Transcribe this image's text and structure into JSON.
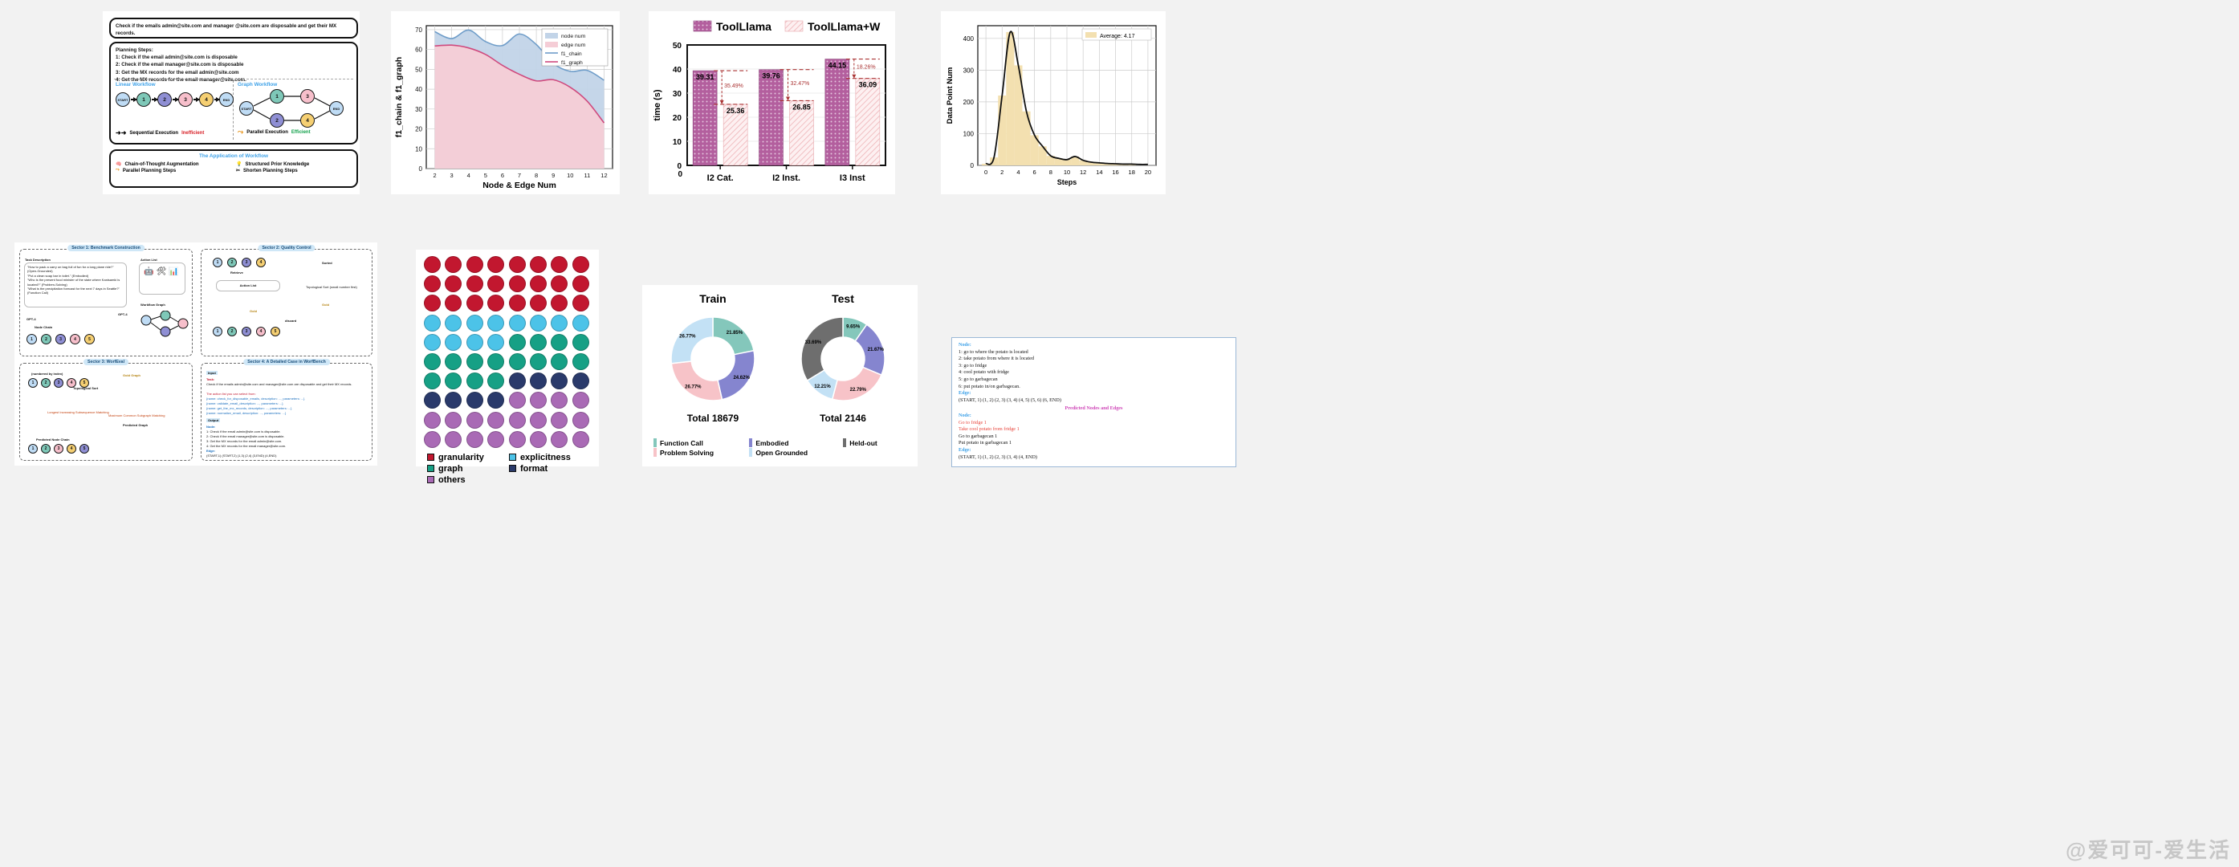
{
  "panel_workflow": {
    "task_text": "Check if the emails admin@site.com and manager @site.com are disposable and get their MX records.",
    "planning_heading": "Planning Steps:",
    "planning_steps": [
      "1: Check if the email admin@site.com is disposable",
      "2: Check if the email manager@site.com is disposable",
      "3: Get the MX records for the email admin@site.com",
      "4: Get the MX records for the email manager@site.com."
    ],
    "linear_title": "Linear Workflow",
    "graph_title": "Graph Workflow",
    "linear_nodes": [
      "START",
      "1",
      "2",
      "3",
      "4",
      "END"
    ],
    "graph_nodes": [
      "START",
      "1",
      "2",
      "3",
      "4",
      "END"
    ],
    "linear_caption_a": "Sequential Execution",
    "linear_caption_b": "Inefficient",
    "graph_caption_a": "Parallel Execution",
    "graph_caption_b": "Efficient",
    "application_title": "The Application of Workflow",
    "applications": [
      "Chain-of-Thought Augmentation",
      "Structured Prior Knowledge",
      "Parallel Planning Steps",
      "Shorten Planning Steps"
    ]
  },
  "chart_data": [
    {
      "id": "area_chart",
      "type": "area",
      "title": "",
      "xlabel": "Node & Edge Num",
      "ylabel": "f1_chain & f1_graph",
      "xlim": [
        1.5,
        12.5
      ],
      "ylim": [
        0,
        72
      ],
      "xticks": [
        2,
        3,
        4,
        5,
        6,
        7,
        8,
        9,
        10,
        11,
        12
      ],
      "yticks": [
        0,
        10,
        20,
        30,
        40,
        50,
        60,
        70
      ],
      "grid": true,
      "legend_position": "upper right",
      "legend": [
        "node num",
        "edge num",
        "f1_chain",
        "f1_graph"
      ],
      "colors": {
        "node num": "#c2d4e8",
        "edge num": "#f5cdd6",
        "f1_chain": "#6f9dc9",
        "f1_graph": "#cf4a7e"
      },
      "x": [
        2,
        3,
        4,
        5,
        6,
        7,
        8,
        9,
        10,
        11,
        12
      ],
      "series": [
        {
          "name": "f1_chain",
          "values": [
            69.0,
            65.5,
            69.8,
            64.0,
            62.0,
            67.8,
            62.5,
            53.0,
            49.0,
            49.5,
            44.5
          ]
        },
        {
          "name": "f1_graph",
          "values": [
            61.8,
            62.2,
            60.8,
            57.5,
            52.0,
            47.5,
            44.2,
            44.8,
            41.0,
            34.0,
            23.0
          ]
        }
      ]
    },
    {
      "id": "latency_bar_chart",
      "type": "bar",
      "title": "",
      "xlabel": "",
      "ylabel": "time (s)",
      "categories": [
        "I2 Cat.",
        "I2 Inst.",
        "I3 Inst"
      ],
      "ylim": [
        0,
        50
      ],
      "yticks": [
        0,
        10,
        20,
        30,
        40,
        50
      ],
      "grid": true,
      "legend_position": "top",
      "series": [
        {
          "name": "ToolLlama",
          "values": [
            39.31,
            39.76,
            44.15
          ],
          "color": "#b35f9e"
        },
        {
          "name": "ToolLlama+W",
          "values": [
            25.36,
            26.85,
            36.09
          ],
          "color": "#f7dde0"
        }
      ],
      "annotations": [
        "35.49%",
        "32.47%",
        "18.26%"
      ]
    },
    {
      "id": "steps_kde",
      "type": "area",
      "title": "",
      "xlabel": "Steps",
      "ylabel": "Data Point Num",
      "xlim": [
        -1,
        21
      ],
      "ylim": [
        0,
        440
      ],
      "xticks": [
        0,
        2,
        4,
        6,
        8,
        10,
        12,
        14,
        16,
        18,
        20
      ],
      "yticks": [
        0,
        100,
        200,
        300,
        400
      ],
      "grid": true,
      "legend": [
        "Average: 4.17"
      ],
      "legend_position": "upper right",
      "hist_color": "#f3e0b0",
      "line_color": "#111111",
      "x": [
        0,
        1,
        2,
        3,
        4,
        5,
        6,
        7,
        8,
        9,
        10,
        11,
        12,
        13,
        14,
        15,
        16,
        17,
        18,
        19,
        20
      ],
      "values": [
        5,
        25,
        220,
        420,
        315,
        170,
        95,
        60,
        30,
        22,
        18,
        28,
        16,
        10,
        8,
        6,
        5,
        4,
        4,
        3,
        3
      ]
    },
    {
      "id": "train_donut",
      "type": "pie",
      "title": "Train",
      "total_label": "Total 18679",
      "labels": [
        "Function Call",
        "Embodied",
        "Problem Solving",
        "Open Grounded"
      ],
      "values": [
        21.85,
        24.62,
        26.77,
        26.77
      ],
      "value_labels": [
        "21.85%",
        "24.62%",
        "26.77%",
        "26.77%"
      ],
      "colors": [
        "#84c7bb",
        "#8585cf",
        "#f7c3c8",
        "#c3e1f5"
      ]
    },
    {
      "id": "test_donut",
      "type": "pie",
      "title": "Test",
      "total_label": "Total 2146",
      "labels": [
        "Function Call",
        "Embodied",
        "Problem Solving",
        "Open Grounded",
        "Held-out"
      ],
      "values": [
        9.65,
        21.67,
        22.79,
        12.21,
        33.69
      ],
      "value_labels": [
        "9.65%",
        "21.67%",
        "22.79%",
        "12.21%",
        "33.69%"
      ],
      "colors": [
        "#84c7bb",
        "#8585cf",
        "#f7c3c8",
        "#c3e1f5",
        "#6e6e6e"
      ]
    },
    {
      "id": "category_dot_matrix",
      "type": "scatter",
      "title": "",
      "legend": [
        "granularity",
        "explicitness",
        "graph",
        "format",
        "others"
      ],
      "colors": [
        "#c2172f",
        "#4cc3e8",
        "#16a085",
        "#2a3a6b",
        "#a96ab5"
      ],
      "rows": 10,
      "cols": 8,
      "counts": {
        "granularity": 24,
        "explicitness": 12,
        "graph": 16,
        "format": 8,
        "others": 20
      }
    }
  ],
  "pie_section": {
    "legend": [
      {
        "label": "Function Call",
        "color": "#84c7bb"
      },
      {
        "label": "Embodied",
        "color": "#8585cf"
      },
      {
        "label": "Held-out",
        "color": "#6e6e6e"
      },
      {
        "label": "Problem Solving",
        "color": "#f7c3c8"
      },
      {
        "label": "Open Grounded",
        "color": "#c3e1f5"
      }
    ]
  },
  "dot_legend": [
    {
      "label": "granularity",
      "color": "#c2172f"
    },
    {
      "label": "explicitness",
      "color": "#4cc3e8"
    },
    {
      "label": "graph",
      "color": "#16a085"
    },
    {
      "label": "format",
      "color": "#2a3a6b"
    },
    {
      "label": "others",
      "color": "#a96ab5"
    }
  ],
  "framework": {
    "sector1_title": "Sector 1: Benchmark Construction",
    "sector2_title": "Sector 2: Quality Control",
    "sector3_title": "Sector 3: WorfEval",
    "sector4_title": "Sector 4: A Detailed Case in WorfBench",
    "task_description_title": "Task Description",
    "action_list_title": "Action List",
    "examples": [
      "\"How to pack a carry on bag full of fun for a long plane ride?\"  (Open-Grounded)",
      "\"Put a clean soap bar in toilet.\"  (Embodied)",
      "\"Who is the present food minister of the state where Kanisamki is located?\"  (Problem-Solving)",
      "\"What is the precipitation forecast for the next 7 days in Seattle?\"  (Function Call)"
    ],
    "gpt4_label": "GPT-4",
    "node_chain_label": "Node Chain",
    "workflow_graph_label": "Workflow Graph",
    "retrieve_label": "Retrieve",
    "action_list_label": "Action List",
    "sorted_label": "Sorted",
    "topological_sort_label": "Topological Sort (small number first)",
    "gold_label": "Gold",
    "discard_label": "discard",
    "numbered_by_index": "(numbered by index)",
    "topological_sort": "Topological Sort",
    "gold_graph": "Gold Graph",
    "lis_label": "Longest Increasing Subsequence Matching",
    "mcs_label": "Maximum Common Subgraph Matching",
    "predicted_graph": "Predicted Graph",
    "predicted_node_chain": "Predicted Node Chain",
    "case_input_label": "Input",
    "case_task_label": "Task:",
    "case_task": "Check if the emails admin@site.com and manager@site.com are disposable and get their MX records.",
    "case_action_label": "The action list you can select from:",
    "case_actions": [
      "{name: check_for_disposable_emails, description: ..., parameters: ...}",
      "{name: validate_email_description: ..., parameters: ...}",
      "{name: get_the_mx_records, description: ..., parameters: ...}",
      "{name: normalize_email, description: ..., parameters: ...}"
    ],
    "case_output_label": "Output",
    "case_node_label": "Node:",
    "case_nodes": [
      "1: Check if the email admin@site.com is disposable.",
      "2: Check if the email manager@site.com is disposable.",
      "3: Get the MX records for the email admin@site.com.",
      "4: Get the MX records for the email manager@site.com."
    ],
    "case_edge_label": "Edge:",
    "case_edges": "(START,1) (START,2) (1,3) (2,4) (3,END) (4,END)"
  },
  "case_panel": {
    "node_label": "Node:",
    "nodes": [
      "1: go to where the potato is located",
      "2: take potato from where it is located",
      "3: go to fridge",
      "4: cool potato with fridge",
      "5: go to garbagecan",
      "6: put potato in/on garbagecan."
    ],
    "edge_label": "Edge:",
    "edges": "(START, 1) (1, 2) (2, 3) (3, 4) (4, 5) (5, 6) (6, END)",
    "predicted_title": "Predicted Nodes and Edges",
    "pred_node_label": "Node:",
    "pred_nodes": [
      {
        "text": "Go to fridge 1",
        "highlight": true
      },
      {
        "text": "Take cool potato from fridge 1",
        "highlight": true
      },
      {
        "text": "Go to garbagecan 1",
        "highlight": false
      },
      {
        "text": "Put potato in garbagecan 1",
        "highlight": false
      }
    ],
    "pred_edge_label": "Edge:",
    "pred_edges": "(START, 1) (1, 2) (2, 3) (3, 4) (4, END)"
  },
  "watermark": "@爱可可-爱生活"
}
